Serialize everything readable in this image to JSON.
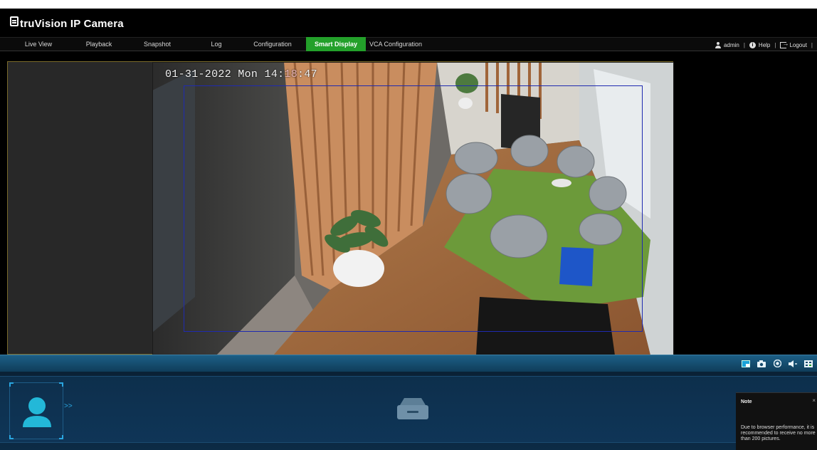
{
  "header": {
    "brand": "truVision IP Camera",
    "brand_icon": "camera-logo-icon"
  },
  "nav": {
    "items": [
      {
        "label": "Live View",
        "active": false
      },
      {
        "label": "Playback",
        "active": false
      },
      {
        "label": "Snapshot",
        "active": false
      },
      {
        "label": "Log",
        "active": false
      },
      {
        "label": "Configuration",
        "active": false
      },
      {
        "label": "Smart Display",
        "active": true
      },
      {
        "label": "VCA Configuration",
        "active": false
      }
    ],
    "user": "admin",
    "help": "Help",
    "logout": "Logout",
    "separator": "|"
  },
  "video": {
    "osd_timestamp_prefix": "01-31-2022 Mon 14:",
    "osd_timestamp_min": "18",
    "osd_timestamp_sec": ":47",
    "vca_rect_color": "#1f2ab0"
  },
  "controls": {
    "icons": [
      "window-layout-icon",
      "snapshot-camera-icon",
      "record-icon",
      "audio-icon",
      "stream-settings-icon"
    ]
  },
  "smart_panel": {
    "face_icon": "person-silhouette-icon",
    "empty_icon": "empty-tray-icon",
    "expand_arrow": ">>"
  },
  "note": {
    "title": "Note",
    "close": "×",
    "body": "Due to browser performance, it is\nrecommended to receive no more\nthan 200 pictures."
  },
  "colors": {
    "active_tab": "#23a02a",
    "accent": "#2aa6e0",
    "panel_bg": "#0f3557"
  }
}
